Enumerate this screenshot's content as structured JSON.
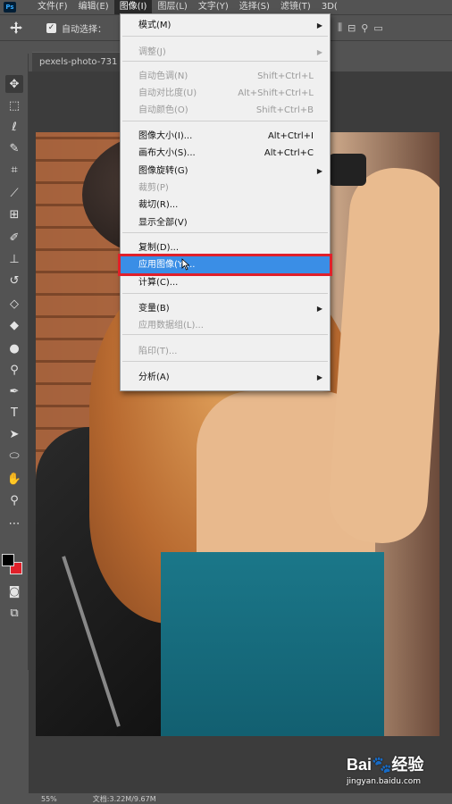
{
  "app": {
    "logo": "Ps"
  },
  "menubar": {
    "items": [
      {
        "label": "文件(F)"
      },
      {
        "label": "编辑(E)"
      },
      {
        "label": "图像(I)"
      },
      {
        "label": "图层(L)"
      },
      {
        "label": "文字(Y)"
      },
      {
        "label": "选择(S)"
      },
      {
        "label": "滤镜(T)"
      },
      {
        "label": "3D("
      }
    ],
    "active": "图像(I)"
  },
  "options": {
    "auto_select_label": "自动选择：",
    "auto_select_checked": true
  },
  "document": {
    "tab_title": "pexels-photo-731"
  },
  "image_menu": {
    "items": [
      {
        "label": "模式(M)",
        "shortcut": "",
        "submenu": true,
        "disabled": false
      },
      {
        "label": "调整(J)",
        "shortcut": "",
        "submenu": true,
        "disabled": true
      },
      {
        "label": "自动色调(N)",
        "shortcut": "Shift+Ctrl+L",
        "submenu": false,
        "disabled": true
      },
      {
        "label": "自动对比度(U)",
        "shortcut": "Alt+Shift+Ctrl+L",
        "submenu": false,
        "disabled": true
      },
      {
        "label": "自动颜色(O)",
        "shortcut": "Shift+Ctrl+B",
        "submenu": false,
        "disabled": true
      },
      {
        "label": "图像大小(I)...",
        "shortcut": "Alt+Ctrl+I",
        "submenu": false,
        "disabled": false
      },
      {
        "label": "画布大小(S)...",
        "shortcut": "Alt+Ctrl+C",
        "submenu": false,
        "disabled": false
      },
      {
        "label": "图像旋转(G)",
        "shortcut": "",
        "submenu": true,
        "disabled": false
      },
      {
        "label": "裁剪(P)",
        "shortcut": "",
        "submenu": false,
        "disabled": true
      },
      {
        "label": "裁切(R)...",
        "shortcut": "",
        "submenu": false,
        "disabled": false
      },
      {
        "label": "显示全部(V)",
        "shortcut": "",
        "submenu": false,
        "disabled": false
      },
      {
        "label": "复制(D)...",
        "shortcut": "",
        "submenu": false,
        "disabled": false
      },
      {
        "label": "应用图像(Y)...",
        "shortcut": "",
        "submenu": false,
        "disabled": false,
        "highlighted": true
      },
      {
        "label": "计算(C)...",
        "shortcut": "",
        "submenu": false,
        "disabled": false
      },
      {
        "label": "变量(B)",
        "shortcut": "",
        "submenu": true,
        "disabled": false
      },
      {
        "label": "应用数据组(L)...",
        "shortcut": "",
        "submenu": false,
        "disabled": true
      },
      {
        "label": "陷印(T)...",
        "shortcut": "",
        "submenu": false,
        "disabled": true
      },
      {
        "label": "分析(A)",
        "shortcut": "",
        "submenu": true,
        "disabled": false
      }
    ]
  },
  "status": {
    "zoom": "55%",
    "doc_info": "文档:3.22M/9.67M"
  },
  "watermark": {
    "brand": "Bai🐾经验",
    "url": "jingyan.baidu.com"
  },
  "colors": {
    "highlight": "#3a8ee6",
    "highlight_outline": "#e0202a",
    "foreground_swatch": "#000000",
    "background_swatch": "#e0202a"
  }
}
